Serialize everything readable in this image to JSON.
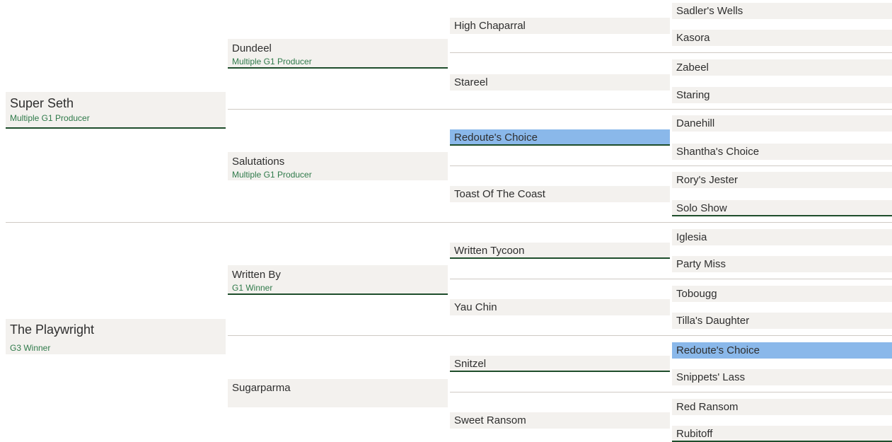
{
  "pedigree": {
    "gen1": [
      {
        "name": "Super Seth",
        "badge": "Multiple G1 Producer"
      },
      {
        "name": "The Playwright",
        "badge": "G3 Winner"
      }
    ],
    "gen2": [
      {
        "name": "Dundeel",
        "badge": "Multiple G1 Producer"
      },
      {
        "name": "Salutations",
        "badge": "Multiple G1 Producer"
      },
      {
        "name": "Written By",
        "badge": "G1 Winner"
      },
      {
        "name": "Sugarparma"
      }
    ],
    "gen3": [
      {
        "name": "High Chaparral"
      },
      {
        "name": "Stareel"
      },
      {
        "name": "Redoute's Choice",
        "highlighted": true
      },
      {
        "name": "Toast Of The Coast"
      },
      {
        "name": "Written Tycoon"
      },
      {
        "name": "Yau Chin"
      },
      {
        "name": "Snitzel"
      },
      {
        "name": "Sweet Ransom"
      }
    ],
    "gen4": [
      {
        "name": "Sadler's Wells"
      },
      {
        "name": "Kasora"
      },
      {
        "name": "Zabeel"
      },
      {
        "name": "Staring"
      },
      {
        "name": "Danehill"
      },
      {
        "name": "Shantha's Choice"
      },
      {
        "name": "Rory's Jester"
      },
      {
        "name": "Solo Show"
      },
      {
        "name": "Iglesia"
      },
      {
        "name": "Party Miss"
      },
      {
        "name": "Tobougg"
      },
      {
        "name": "Tilla's Daughter"
      },
      {
        "name": "Redoute's Choice",
        "highlighted": true
      },
      {
        "name": "Snippets' Lass"
      },
      {
        "name": "Red Ransom"
      },
      {
        "name": "Rubitoff"
      }
    ]
  }
}
